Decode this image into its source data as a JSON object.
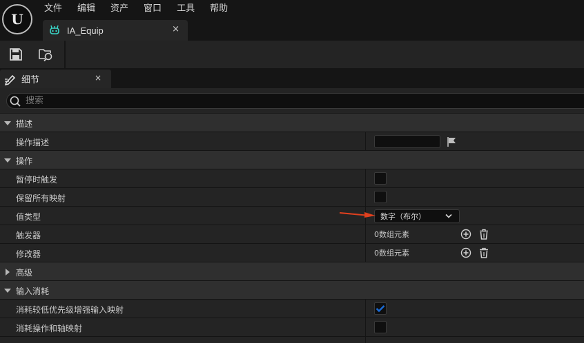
{
  "app": {
    "logo_text": "U",
    "menu": [
      "文件",
      "编辑",
      "资产",
      "窗口",
      "工具",
      "帮助"
    ],
    "asset_tab": {
      "label": "IA_Equip",
      "close": "×",
      "icon": "input-action-icon"
    }
  },
  "toolbar": {
    "buttons": [
      {
        "name": "save-button",
        "icon": "save-icon"
      },
      {
        "name": "browse-button",
        "icon": "browse-folder-icon"
      }
    ]
  },
  "details": {
    "tab": {
      "label": "细节",
      "close": "×",
      "icon": "pencil-icon"
    },
    "search": {
      "placeholder": "搜索"
    },
    "rows": [
      {
        "kind": "category",
        "label": "描述",
        "expanded": true
      },
      {
        "kind": "property",
        "label": "操作描述",
        "widget": "text",
        "value": ""
      },
      {
        "kind": "category",
        "label": "操作",
        "expanded": true
      },
      {
        "kind": "property",
        "label": "暂停时触发",
        "widget": "checkbox",
        "checked": false
      },
      {
        "kind": "property",
        "label": "保留所有映射",
        "widget": "checkbox",
        "checked": false
      },
      {
        "kind": "property",
        "label": "值类型",
        "widget": "dropdown",
        "value": "数字（布尔）"
      },
      {
        "kind": "property",
        "label": "触发器",
        "widget": "array",
        "value": "0数组元素"
      },
      {
        "kind": "property",
        "label": "修改器",
        "widget": "array",
        "value": "0数组元素"
      },
      {
        "kind": "category",
        "label": "高级",
        "expanded": false
      },
      {
        "kind": "category",
        "label": "输入消耗",
        "expanded": true
      },
      {
        "kind": "property",
        "label": "消耗较低优先级增强输入映射",
        "widget": "checkbox",
        "checked": true
      },
      {
        "kind": "property",
        "label": "消耗操作和轴映射",
        "widget": "checkbox",
        "checked": false
      }
    ]
  },
  "colors": {
    "accent": "#1a6bd6",
    "annotation_arrow": "#e0401e",
    "asset_icon": "#3ad6c8"
  }
}
